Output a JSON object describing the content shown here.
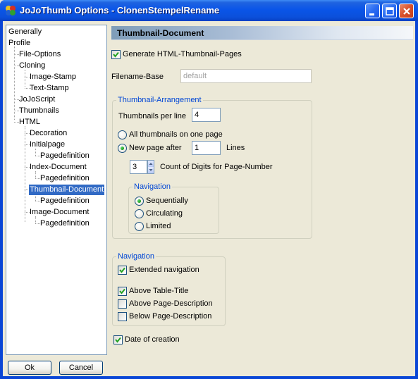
{
  "window": {
    "title": "JoJoThumb Options - ClonenStempelRename",
    "controls": [
      "minimize-icon",
      "maximize-icon",
      "close-icon"
    ]
  },
  "tree": {
    "items": [
      {
        "label": "Generally"
      },
      {
        "label": "Profile"
      },
      {
        "label": "File-Options"
      },
      {
        "label": "Cloning"
      },
      {
        "label": "Image-Stamp"
      },
      {
        "label": "Text-Stamp"
      },
      {
        "label": "JoJoScript"
      },
      {
        "label": "Thumbnails"
      },
      {
        "label": "HTML"
      },
      {
        "label": "Decoration"
      },
      {
        "label": "Initialpage"
      },
      {
        "label": "Pagedefinition"
      },
      {
        "label": "Index-Document"
      },
      {
        "label": "Pagedefinition"
      },
      {
        "label": "Thumbnail-Document",
        "selected": true
      },
      {
        "label": "Pagedefinition"
      },
      {
        "label": "Image-Document"
      },
      {
        "label": "Pagedefinition"
      }
    ]
  },
  "buttons": {
    "ok": "Ok",
    "cancel": "Cancel"
  },
  "panel": {
    "header": "Thumbnail-Document",
    "generate_html": {
      "label": "Generate HTML-Thumbnail-Pages",
      "checked": true
    },
    "filename_base": {
      "label": "Filename-Base",
      "placeholder": "default"
    },
    "arrangement": {
      "title": "Thumbnail-Arrangement",
      "per_line_label": "Thumbnails per line",
      "per_line_value": "4",
      "all_on_one": {
        "label": "All thumbnails on one page",
        "checked": false
      },
      "new_page_after": {
        "label": "New page after",
        "checked": true,
        "value": "1",
        "suffix": "Lines"
      },
      "digits": {
        "value": "3",
        "label": "Count of Digits for Page-Number"
      },
      "navigation": {
        "title": "Navigation",
        "options": [
          {
            "label": "Sequentially",
            "checked": true
          },
          {
            "label": "Circulating",
            "checked": false
          },
          {
            "label": "Limited",
            "checked": false
          }
        ]
      }
    },
    "navigation": {
      "title": "Navigation",
      "extended": {
        "label": "Extended navigation",
        "checked": true
      },
      "above_title": {
        "label": "Above Table-Title",
        "checked": true
      },
      "above_desc": {
        "label": "Above Page-Description",
        "checked": false
      },
      "below_desc": {
        "label": "Below Page-Description",
        "checked": false
      }
    },
    "date_of_creation": {
      "label": "Date of creation",
      "checked": true
    }
  },
  "colors": {
    "titlebar": "#0a55e8",
    "selection": "#316ac5",
    "group_title": "#0046d5",
    "face": "#ece9d8"
  }
}
